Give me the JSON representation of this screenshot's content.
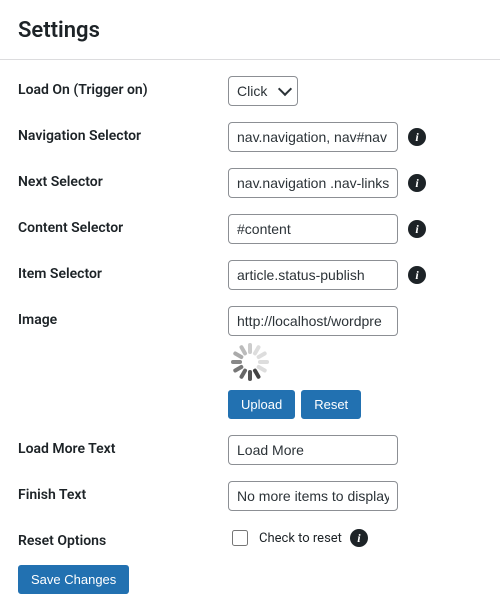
{
  "page": {
    "title": "Settings"
  },
  "fields": {
    "load_on": {
      "label": "Load On (Trigger on)",
      "value": "Click"
    },
    "nav_sel": {
      "label": "Navigation Selector",
      "value": "nav.navigation, nav#nav"
    },
    "next_sel": {
      "label": "Next Selector",
      "value": "nav.navigation .nav-links"
    },
    "content_sel": {
      "label": "Content Selector",
      "value": "#content"
    },
    "item_sel": {
      "label": "Item Selector",
      "value": "article.status-publish"
    },
    "image": {
      "label": "Image",
      "value": "http://localhost/wordpre"
    },
    "load_more": {
      "label": "Load More Text",
      "value": "Load More"
    },
    "finish": {
      "label": "Finish Text",
      "value": "No more items to display"
    },
    "reset": {
      "label": "Reset Options",
      "checkbox_label": "Check to reset"
    }
  },
  "buttons": {
    "upload": "Upload",
    "reset": "Reset",
    "save": "Save Changes"
  }
}
